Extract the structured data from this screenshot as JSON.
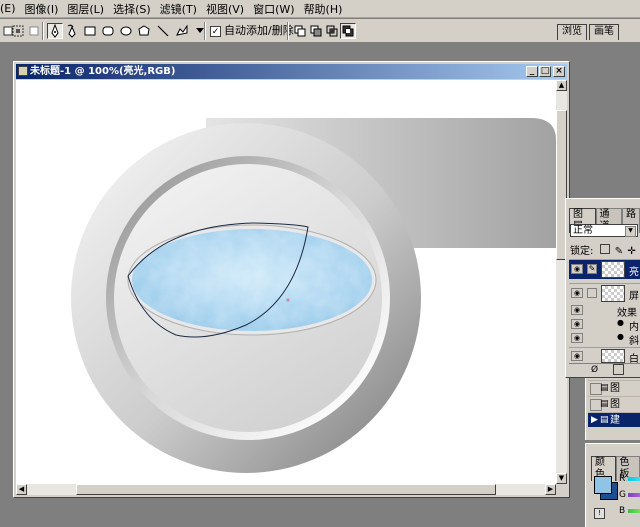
{
  "menu": {
    "items": [
      "(E)",
      "图像(I)",
      "图层(L)",
      "选择(S)",
      "滤镜(T)",
      "视图(V)",
      "窗口(W)",
      "帮助(H)"
    ]
  },
  "options": {
    "auto_add_delete_label": "自动添加/删除",
    "auto_add_delete_checked": "✓"
  },
  "top_tabs": [
    "浏览",
    "画笔"
  ],
  "document": {
    "title": "未标题-1 @ 100%(亮光,RGB)"
  },
  "layers_panel": {
    "tabs": [
      "图层",
      "通道",
      "路"
    ],
    "blend_mode": "正常",
    "lock_label": "锁定:",
    "layers": [
      {
        "name": "亮"
      },
      {
        "name": "屏"
      },
      {
        "name": "效果"
      },
      {
        "name": "内"
      },
      {
        "name": "斜"
      },
      {
        "name": "白"
      }
    ]
  },
  "history_panel": {
    "items": [
      "图",
      "图",
      "建"
    ]
  },
  "color_panel": {
    "tabs": [
      "颜色",
      "色板"
    ],
    "channels": [
      "R",
      "G",
      "B"
    ],
    "foreground": "#8fc4e6",
    "background": "#1d4f8f"
  }
}
